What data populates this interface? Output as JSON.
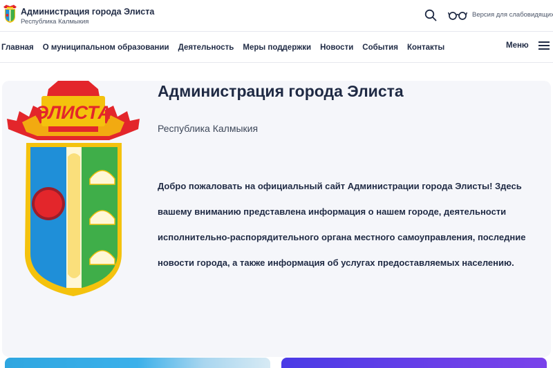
{
  "header": {
    "brand_title": "Администрация города Элиста",
    "brand_subtitle": "Республика Калмыкия",
    "accessibility_link": "Версия для слабовидящих",
    "icons": [
      "coat-of-arms-icon",
      "search-icon",
      "glasses-icon"
    ]
  },
  "nav": {
    "items": [
      {
        "label": "Главная"
      },
      {
        "label": "О муниципальном образовании"
      },
      {
        "label": "Деятельность"
      },
      {
        "label": "Меры поддержки"
      },
      {
        "label": "Новости"
      },
      {
        "label": "События"
      },
      {
        "label": "Контакты"
      }
    ],
    "menu_label": "Меню"
  },
  "hero": {
    "title": "Администрация города Элиста",
    "subtitle": "Республика Калмыкия",
    "text": "Добро пожаловать на официальный сайт Администрации города Элисты! Здесь вашему вниманию представлена информация о нашем городе, деятельности исполнительно-распорядительного органа местного самоуправления, последние новости города, а также информация об услугах предоставляемых населению.",
    "coat_label": "ЭЛИСТА"
  },
  "colors": {
    "text": "#1f2a44",
    "hero_bg": "#f5f6fa",
    "coat_red": "#e3262b",
    "coat_yellow": "#f4c20d",
    "coat_blue": "#1f8fd8",
    "coat_green": "#3fae49",
    "card_left": "#2fa6e0",
    "card_right": "#5a3de7"
  }
}
